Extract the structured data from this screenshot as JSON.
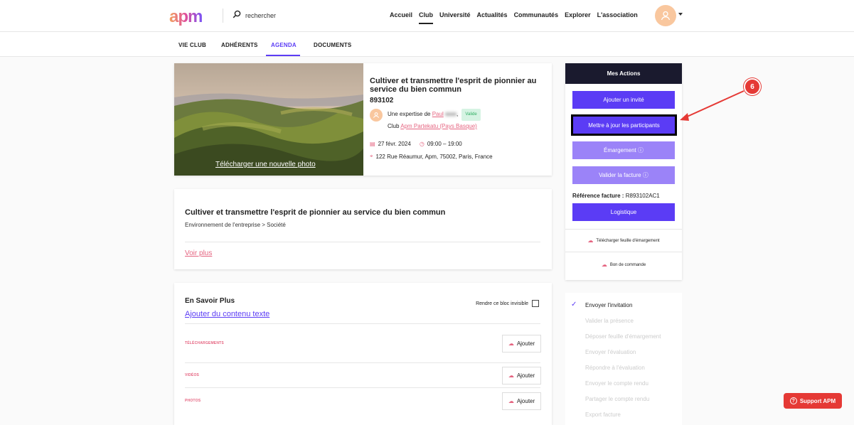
{
  "header": {
    "logo": "apm",
    "search_placeholder": "rechercher",
    "nav": [
      "Accueil",
      "Club",
      "Université",
      "Actualités",
      "Communautés",
      "Explorer",
      "L'association"
    ],
    "active_nav": "Club"
  },
  "tabs": [
    "VIE CLUB",
    "ADHÉRENTS",
    "AGENDA",
    "DOCUMENTS"
  ],
  "active_tab": "AGENDA",
  "event": {
    "upload_photo": "Télécharger une nouvelle photo",
    "title": "Cultiver et transmettre l'esprit de pionnier au service du bien commun",
    "code": "893102",
    "expertise_prefix": "Une expertise de",
    "expert_name": "Paul",
    "status_badge": "Valide",
    "club_prefix": "Club",
    "club_name": "Apm Partekatu (Pays Basque)",
    "date": "27 févr. 2024",
    "time": "09:00 – 19:00",
    "address": "122 Rue Réaumur, Apm, 75002, Paris, France"
  },
  "description": {
    "title": "Cultiver et transmettre l'esprit de pionnier au service du bien commun",
    "category": "Environnement de l'entreprise > Société",
    "see_more": "Voir plus"
  },
  "learn_more": {
    "title": "En Savoir Plus",
    "add_text": "Ajouter du contenu texte",
    "invisible_label": "Rendre ce bloc invisible",
    "sections": [
      "TÉLÉCHARGEMENTS",
      "VIDÉOS",
      "PHOTOS"
    ],
    "add_label": "Ajouter"
  },
  "actions": {
    "title": "Mes Actions",
    "add_guest": "Ajouter un invité",
    "update_participants": "Mettre à jour les participants",
    "attendance": "Émargement ⓘ",
    "validate_invoice": "Valider la facture ⓘ",
    "invoice_ref_label": "Référence facture :",
    "invoice_ref": "R893102AC1",
    "logistics": "Logistique",
    "download_sheet": "Télécharger feuille d'émargement",
    "order_form": "Bon de commande"
  },
  "steps": {
    "items": [
      "Envoyer l'invitation",
      "Valider la présence",
      "Déposer feuille d'émargement",
      "Envoyer l'évaluation",
      "Répondre à l'évaluation",
      "Envoyer le compte rendu",
      "Partager le compte rendu",
      "Export facture"
    ],
    "done_count": 1
  },
  "annotation": {
    "number": "6",
    "color": "#e53935"
  },
  "support": {
    "label": "Support APM"
  },
  "colors": {
    "accent": "#5b3cf5",
    "pink": "#e56480",
    "dark_header": "#1a1a2e"
  }
}
